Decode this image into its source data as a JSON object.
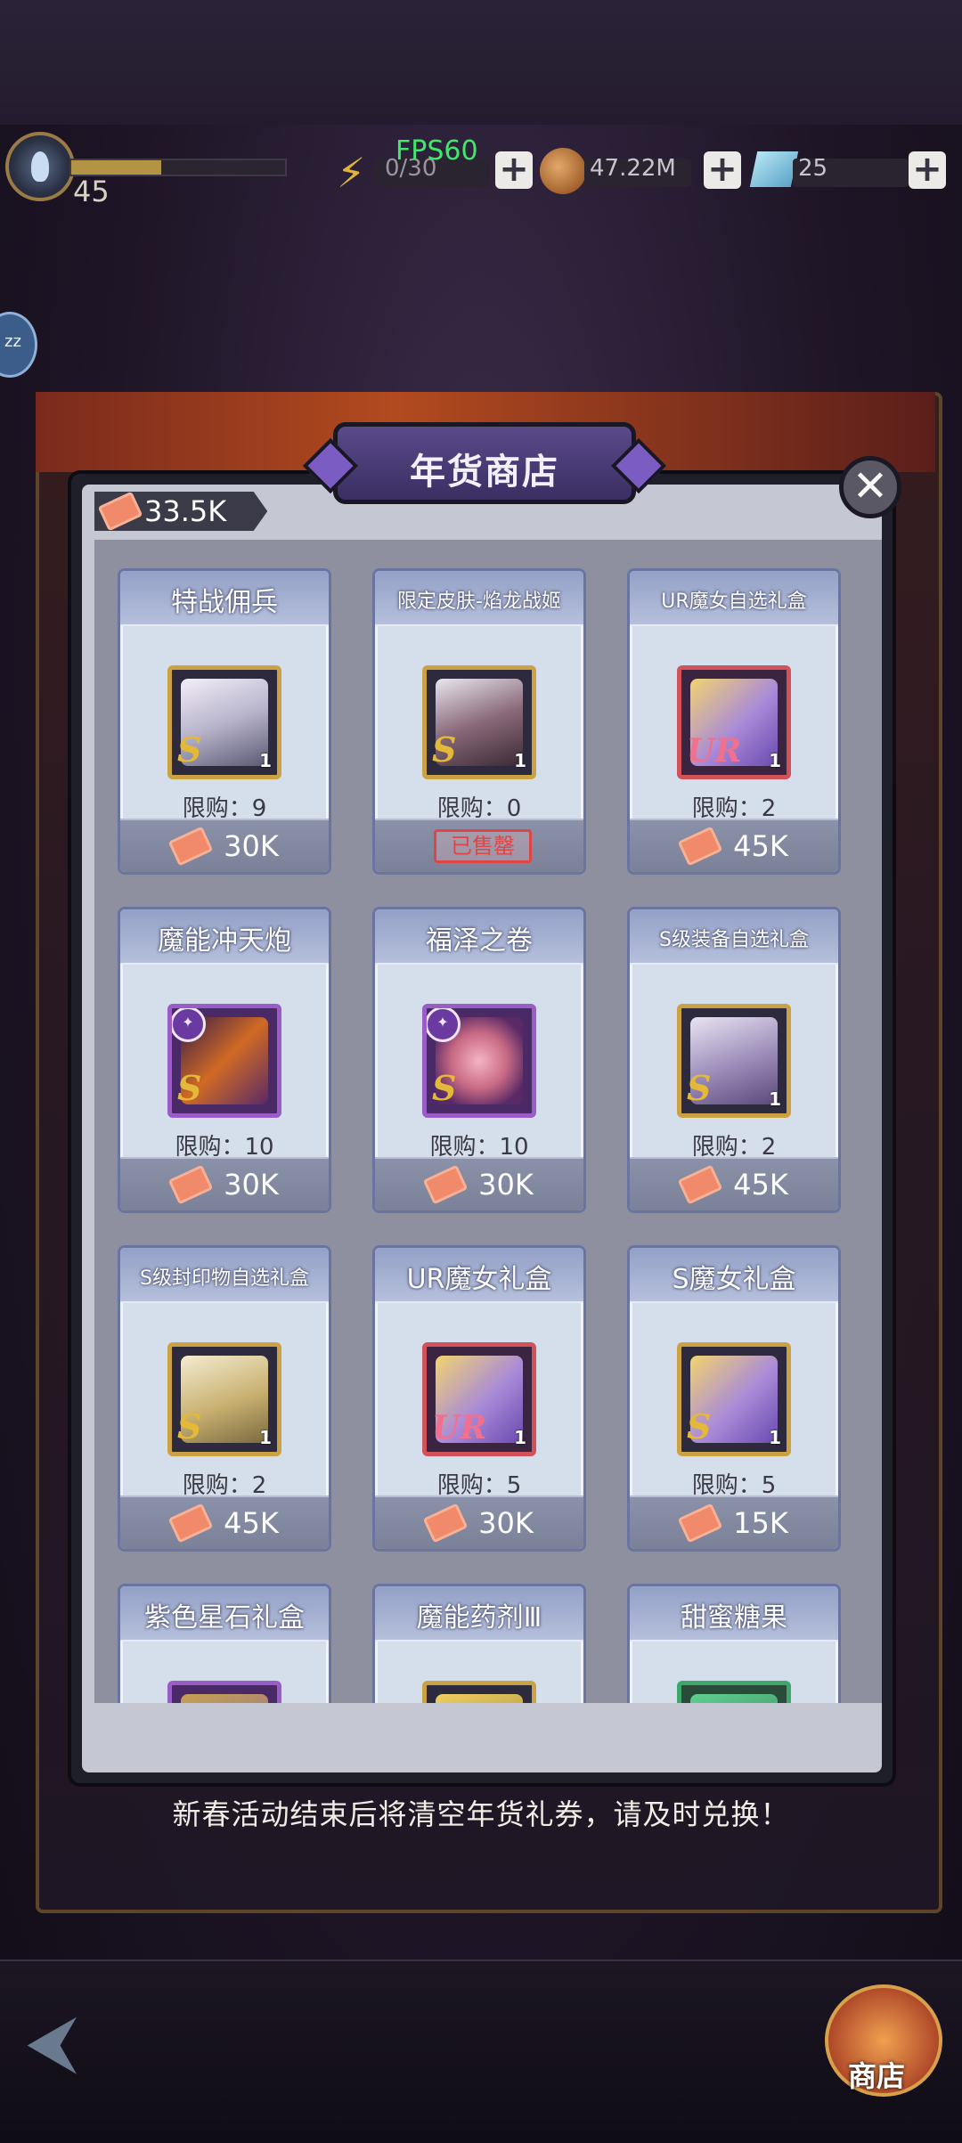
{
  "hud": {
    "fps": "FPS60",
    "level": "45",
    "energy": "0/30",
    "coins": "47.22M",
    "gems": "25",
    "plus_label": "+"
  },
  "side_bubble": "zz",
  "shop": {
    "title": "年货商店",
    "currency_amount": "33.5K",
    "close_label": "✕",
    "items": [
      {
        "name": "特战佣兵",
        "grade": "S",
        "qty": "1",
        "limit": "限购：9",
        "price": "30K",
        "sold_out": false,
        "frame": "gold",
        "icon": "mercenary-portrait-icon"
      },
      {
        "name": "限定皮肤-焰龙战姬",
        "grade": "S",
        "qty": "1",
        "limit": "限购：0",
        "price": "已售罄",
        "sold_out": true,
        "frame": "gold",
        "icon": "skin-portrait-icon"
      },
      {
        "name": "UR魔女自选礼盒",
        "grade": "UR",
        "qty": "1",
        "limit": "限购：2",
        "price": "45K",
        "sold_out": false,
        "frame": "red",
        "icon": "gift-box-icon"
      },
      {
        "name": "魔能冲天炮",
        "grade": "S",
        "qty": "",
        "limit": "限购：10",
        "price": "30K",
        "sold_out": false,
        "frame": "purple",
        "icon": "firework-rocket-icon"
      },
      {
        "name": "福泽之卷",
        "grade": "S",
        "qty": "",
        "limit": "限购：10",
        "price": "30K",
        "sold_out": false,
        "frame": "purple",
        "icon": "lotus-scroll-icon"
      },
      {
        "name": "S级装备自选礼盒",
        "grade": "S",
        "qty": "1",
        "limit": "限购：2",
        "price": "45K",
        "sold_out": false,
        "frame": "gold",
        "icon": "treasure-chest-icon"
      },
      {
        "name": "S级封印物自选礼盒",
        "grade": "S",
        "qty": "1",
        "limit": "限购：2",
        "price": "45K",
        "sold_out": false,
        "frame": "gold",
        "icon": "gold-chest-icon"
      },
      {
        "name": "UR魔女礼盒",
        "grade": "UR",
        "qty": "1",
        "limit": "限购：5",
        "price": "30K",
        "sold_out": false,
        "frame": "red",
        "icon": "gift-box-icon"
      },
      {
        "name": "S魔女礼盒",
        "grade": "S",
        "qty": "1",
        "limit": "限购：5",
        "price": "15K",
        "sold_out": false,
        "frame": "gold",
        "icon": "gift-box-icon"
      },
      {
        "name": "紫色星石礼盒",
        "grade": "",
        "qty": "",
        "limit": "",
        "price": "",
        "sold_out": false,
        "frame": "purple",
        "icon": "star-stone-icon"
      },
      {
        "name": "魔能药剂Ⅲ",
        "grade": "",
        "qty": "",
        "limit": "",
        "price": "",
        "sold_out": false,
        "frame": "gold",
        "icon": "potion-icon"
      },
      {
        "name": "甜蜜糖果",
        "grade": "",
        "qty": "",
        "limit": "",
        "price": "",
        "sold_out": false,
        "frame": "green",
        "icon": "candy-icon"
      }
    ]
  },
  "notice": "新春活动结束后将清空年货礼券，请及时兑换！",
  "bottom_nav": {
    "shop_label": "商店"
  },
  "colors": {
    "panel": "#c5c7d3",
    "card": "#d5dfec",
    "ticket": "#f08a6a",
    "sold_out": "#e04545",
    "fps": "#3fe86a"
  }
}
